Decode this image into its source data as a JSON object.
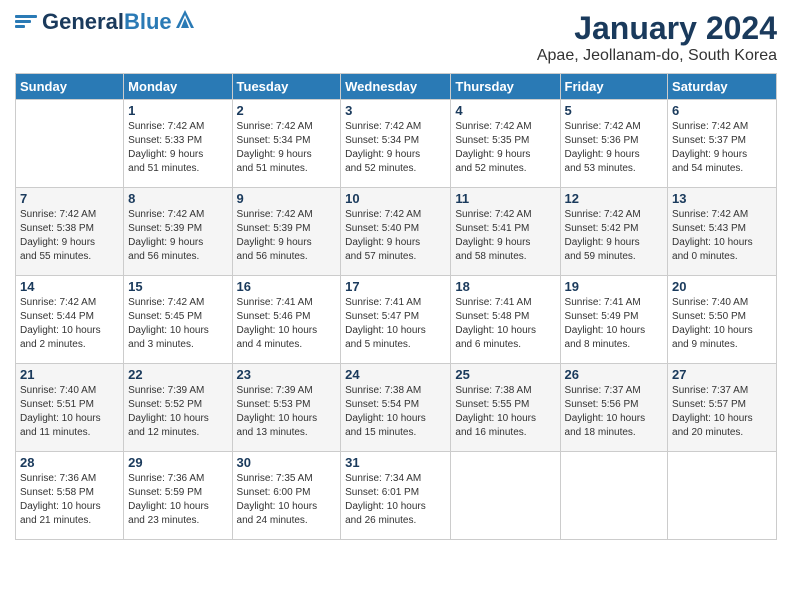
{
  "header": {
    "logo_general": "General",
    "logo_blue": "Blue",
    "month_title": "January 2024",
    "subtitle": "Apae, Jeollanam-do, South Korea"
  },
  "days_of_week": [
    "Sunday",
    "Monday",
    "Tuesday",
    "Wednesday",
    "Thursday",
    "Friday",
    "Saturday"
  ],
  "weeks": [
    [
      {
        "day": "",
        "sunrise": "",
        "sunset": "",
        "daylight": ""
      },
      {
        "day": "1",
        "sunrise": "Sunrise: 7:42 AM",
        "sunset": "Sunset: 5:33 PM",
        "daylight": "Daylight: 9 hours and 51 minutes."
      },
      {
        "day": "2",
        "sunrise": "Sunrise: 7:42 AM",
        "sunset": "Sunset: 5:34 PM",
        "daylight": "Daylight: 9 hours and 51 minutes."
      },
      {
        "day": "3",
        "sunrise": "Sunrise: 7:42 AM",
        "sunset": "Sunset: 5:34 PM",
        "daylight": "Daylight: 9 hours and 52 minutes."
      },
      {
        "day": "4",
        "sunrise": "Sunrise: 7:42 AM",
        "sunset": "Sunset: 5:35 PM",
        "daylight": "Daylight: 9 hours and 52 minutes."
      },
      {
        "day": "5",
        "sunrise": "Sunrise: 7:42 AM",
        "sunset": "Sunset: 5:36 PM",
        "daylight": "Daylight: 9 hours and 53 minutes."
      },
      {
        "day": "6",
        "sunrise": "Sunrise: 7:42 AM",
        "sunset": "Sunset: 5:37 PM",
        "daylight": "Daylight: 9 hours and 54 minutes."
      }
    ],
    [
      {
        "day": "7",
        "sunrise": "Sunrise: 7:42 AM",
        "sunset": "Sunset: 5:38 PM",
        "daylight": "Daylight: 9 hours and 55 minutes."
      },
      {
        "day": "8",
        "sunrise": "Sunrise: 7:42 AM",
        "sunset": "Sunset: 5:39 PM",
        "daylight": "Daylight: 9 hours and 56 minutes."
      },
      {
        "day": "9",
        "sunrise": "Sunrise: 7:42 AM",
        "sunset": "Sunset: 5:39 PM",
        "daylight": "Daylight: 9 hours and 56 minutes."
      },
      {
        "day": "10",
        "sunrise": "Sunrise: 7:42 AM",
        "sunset": "Sunset: 5:40 PM",
        "daylight": "Daylight: 9 hours and 57 minutes."
      },
      {
        "day": "11",
        "sunrise": "Sunrise: 7:42 AM",
        "sunset": "Sunset: 5:41 PM",
        "daylight": "Daylight: 9 hours and 58 minutes."
      },
      {
        "day": "12",
        "sunrise": "Sunrise: 7:42 AM",
        "sunset": "Sunset: 5:42 PM",
        "daylight": "Daylight: 9 hours and 59 minutes."
      },
      {
        "day": "13",
        "sunrise": "Sunrise: 7:42 AM",
        "sunset": "Sunset: 5:43 PM",
        "daylight": "Daylight: 10 hours and 0 minutes."
      }
    ],
    [
      {
        "day": "14",
        "sunrise": "Sunrise: 7:42 AM",
        "sunset": "Sunset: 5:44 PM",
        "daylight": "Daylight: 10 hours and 2 minutes."
      },
      {
        "day": "15",
        "sunrise": "Sunrise: 7:42 AM",
        "sunset": "Sunset: 5:45 PM",
        "daylight": "Daylight: 10 hours and 3 minutes."
      },
      {
        "day": "16",
        "sunrise": "Sunrise: 7:41 AM",
        "sunset": "Sunset: 5:46 PM",
        "daylight": "Daylight: 10 hours and 4 minutes."
      },
      {
        "day": "17",
        "sunrise": "Sunrise: 7:41 AM",
        "sunset": "Sunset: 5:47 PM",
        "daylight": "Daylight: 10 hours and 5 minutes."
      },
      {
        "day": "18",
        "sunrise": "Sunrise: 7:41 AM",
        "sunset": "Sunset: 5:48 PM",
        "daylight": "Daylight: 10 hours and 6 minutes."
      },
      {
        "day": "19",
        "sunrise": "Sunrise: 7:41 AM",
        "sunset": "Sunset: 5:49 PM",
        "daylight": "Daylight: 10 hours and 8 minutes."
      },
      {
        "day": "20",
        "sunrise": "Sunrise: 7:40 AM",
        "sunset": "Sunset: 5:50 PM",
        "daylight": "Daylight: 10 hours and 9 minutes."
      }
    ],
    [
      {
        "day": "21",
        "sunrise": "Sunrise: 7:40 AM",
        "sunset": "Sunset: 5:51 PM",
        "daylight": "Daylight: 10 hours and 11 minutes."
      },
      {
        "day": "22",
        "sunrise": "Sunrise: 7:39 AM",
        "sunset": "Sunset: 5:52 PM",
        "daylight": "Daylight: 10 hours and 12 minutes."
      },
      {
        "day": "23",
        "sunrise": "Sunrise: 7:39 AM",
        "sunset": "Sunset: 5:53 PM",
        "daylight": "Daylight: 10 hours and 13 minutes."
      },
      {
        "day": "24",
        "sunrise": "Sunrise: 7:38 AM",
        "sunset": "Sunset: 5:54 PM",
        "daylight": "Daylight: 10 hours and 15 minutes."
      },
      {
        "day": "25",
        "sunrise": "Sunrise: 7:38 AM",
        "sunset": "Sunset: 5:55 PM",
        "daylight": "Daylight: 10 hours and 16 minutes."
      },
      {
        "day": "26",
        "sunrise": "Sunrise: 7:37 AM",
        "sunset": "Sunset: 5:56 PM",
        "daylight": "Daylight: 10 hours and 18 minutes."
      },
      {
        "day": "27",
        "sunrise": "Sunrise: 7:37 AM",
        "sunset": "Sunset: 5:57 PM",
        "daylight": "Daylight: 10 hours and 20 minutes."
      }
    ],
    [
      {
        "day": "28",
        "sunrise": "Sunrise: 7:36 AM",
        "sunset": "Sunset: 5:58 PM",
        "daylight": "Daylight: 10 hours and 21 minutes."
      },
      {
        "day": "29",
        "sunrise": "Sunrise: 7:36 AM",
        "sunset": "Sunset: 5:59 PM",
        "daylight": "Daylight: 10 hours and 23 minutes."
      },
      {
        "day": "30",
        "sunrise": "Sunrise: 7:35 AM",
        "sunset": "Sunset: 6:00 PM",
        "daylight": "Daylight: 10 hours and 24 minutes."
      },
      {
        "day": "31",
        "sunrise": "Sunrise: 7:34 AM",
        "sunset": "Sunset: 6:01 PM",
        "daylight": "Daylight: 10 hours and 26 minutes."
      },
      {
        "day": "",
        "sunrise": "",
        "sunset": "",
        "daylight": ""
      },
      {
        "day": "",
        "sunrise": "",
        "sunset": "",
        "daylight": ""
      },
      {
        "day": "",
        "sunrise": "",
        "sunset": "",
        "daylight": ""
      }
    ]
  ]
}
